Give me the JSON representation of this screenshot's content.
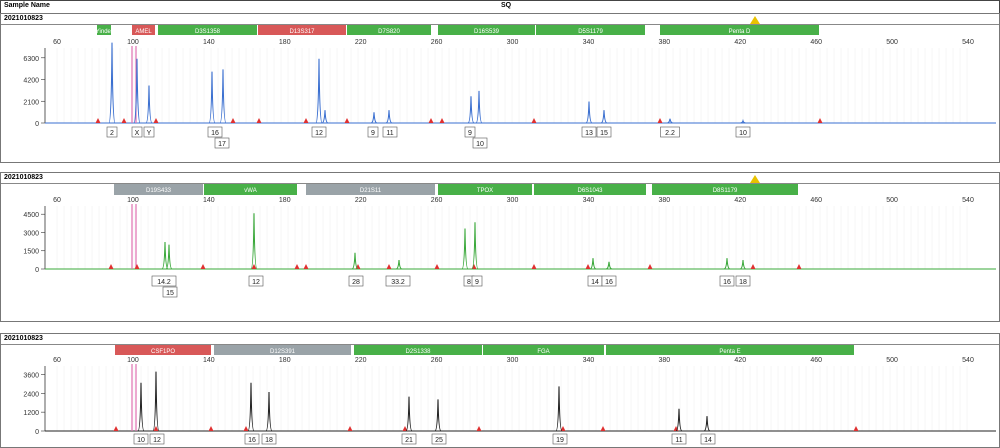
{
  "header": {
    "sample_label": "Sample Name",
    "sample_value": "SQ"
  },
  "colors": {
    "blue": "#3a6fd0",
    "green": "#3aa83a",
    "black": "#222222",
    "red": "#e03030",
    "pink": "#e070b0",
    "bin_green": "#48b048",
    "bin_gray": "#9aa3a8",
    "bin_red": "#d85858"
  },
  "panels": [
    {
      "label": "2021010823",
      "color": "blue",
      "x_ticks": [
        "60",
        "100",
        "140",
        "180",
        "220",
        "260",
        "300",
        "340",
        "380",
        "420",
        "460",
        "500",
        "540"
      ],
      "y_ticks": [
        "6300",
        "4200",
        "2100",
        "0"
      ],
      "loci": [
        {
          "name": "Yindel",
          "color": "bin_green"
        },
        {
          "name": "AMEL",
          "color": "bin_red"
        },
        {
          "name": "D3S1358",
          "color": "bin_green"
        },
        {
          "name": "D13S317",
          "color": "bin_red"
        },
        {
          "name": "D7S820",
          "color": "bin_green"
        },
        {
          "name": "D16S539",
          "color": "bin_green"
        },
        {
          "name": "D5S1179",
          "color": "bin_green"
        },
        {
          "name": "Penta D",
          "color": "bin_green"
        }
      ],
      "alleles": [
        "2",
        "X",
        "Y",
        "16",
        "17",
        "12",
        "9",
        "11",
        "9",
        "10",
        "13",
        "15",
        "2.2",
        "10"
      ]
    },
    {
      "label": "2021010823",
      "color": "green",
      "x_ticks": [
        "60",
        "100",
        "140",
        "180",
        "220",
        "260",
        "300",
        "340",
        "380",
        "420",
        "460",
        "500",
        "540"
      ],
      "y_ticks": [
        "4500",
        "3000",
        "1500",
        "0"
      ],
      "loci": [
        {
          "name": "D19S433",
          "color": "bin_gray"
        },
        {
          "name": "vWA",
          "color": "bin_green"
        },
        {
          "name": "D21S11",
          "color": "bin_gray"
        },
        {
          "name": "TPOX",
          "color": "bin_green"
        },
        {
          "name": "D6S1043",
          "color": "bin_green"
        },
        {
          "name": "D8S1179",
          "color": "bin_green"
        }
      ],
      "alleles": [
        "14.2",
        "15",
        "12",
        "28",
        "33.2",
        "8",
        "9",
        "14",
        "16",
        "16",
        "18"
      ]
    },
    {
      "label": "2021010823",
      "color": "black",
      "x_ticks": [
        "60",
        "100",
        "140",
        "180",
        "220",
        "260",
        "300",
        "340",
        "380",
        "420",
        "460",
        "500",
        "540"
      ],
      "y_ticks": [
        "3600",
        "2400",
        "1200",
        "0"
      ],
      "loci": [
        {
          "name": "CSF1PO",
          "color": "bin_red"
        },
        {
          "name": "D12S391",
          "color": "bin_gray"
        },
        {
          "name": "D2S1338",
          "color": "bin_green"
        },
        {
          "name": "FGA",
          "color": "bin_green"
        },
        {
          "name": "Penta E",
          "color": "bin_green"
        }
      ],
      "alleles": [
        "10",
        "12",
        "16",
        "18",
        "21",
        "25",
        "19",
        "11",
        "14"
      ]
    }
  ]
}
